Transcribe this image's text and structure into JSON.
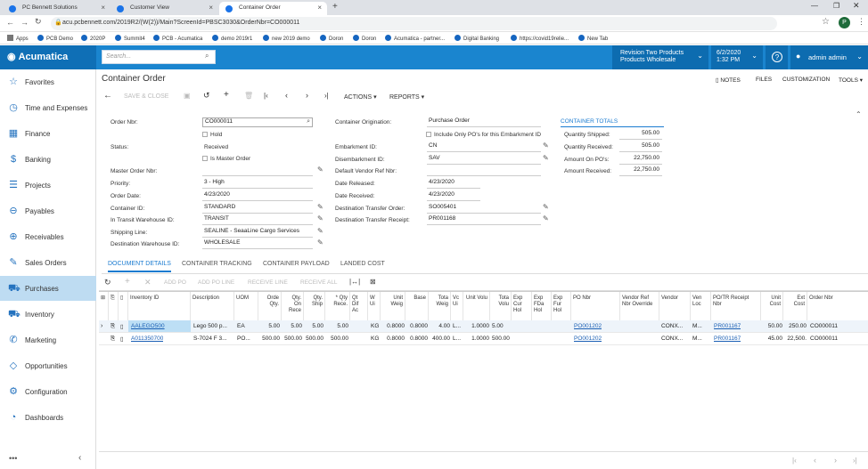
{
  "browser": {
    "tabs": [
      {
        "label": "PC Bennett Solutions"
      },
      {
        "label": "Customer View"
      },
      {
        "label": "Container Order"
      }
    ],
    "url": "acu.pcbennett.com/2019R2/(W(2))/Main?ScreenId=PBSC3030&OrderNbr=CO000011",
    "bookmarks": [
      "Apps",
      "PCB Demo",
      "2020P",
      "Summit4",
      "PCB - Acumatica",
      "demo 2019r1",
      "new 2019 demo",
      "Doron",
      "Doron",
      "Acumatica - partner...",
      "Digital Banking",
      "https://covid19relie...",
      "New Tab"
    ],
    "profile_initial": "P"
  },
  "header": {
    "logo": "Acumatica",
    "search_placeholder": "Search...",
    "company": "Revision Two Products",
    "branch": "Products Wholesale",
    "date": "6/2/2020",
    "time": "1:32 PM",
    "user": "admin admin"
  },
  "sidebar": {
    "items": [
      {
        "label": "Favorites",
        "icon": "star-icon",
        "glyph": "☆"
      },
      {
        "label": "Time and Expenses",
        "icon": "clock-icon",
        "glyph": "◷"
      },
      {
        "label": "Finance",
        "icon": "calculator-icon",
        "glyph": "▦"
      },
      {
        "label": "Banking",
        "icon": "dollar-icon",
        "glyph": "$"
      },
      {
        "label": "Projects",
        "icon": "projects-icon",
        "glyph": "☰"
      },
      {
        "label": "Payables",
        "icon": "minus-circle-icon",
        "glyph": "⊖"
      },
      {
        "label": "Receivables",
        "icon": "plus-circle-icon",
        "glyph": "⊕"
      },
      {
        "label": "Sales Orders",
        "icon": "edit-icon",
        "glyph": "✎"
      },
      {
        "label": "Purchases",
        "icon": "cart-icon",
        "glyph": "⛟"
      },
      {
        "label": "Inventory",
        "icon": "truck-icon",
        "glyph": "⛟"
      },
      {
        "label": "Marketing",
        "icon": "megaphone-icon",
        "glyph": "✆"
      },
      {
        "label": "Opportunities",
        "icon": "tag-icon",
        "glyph": "◇"
      },
      {
        "label": "Configuration",
        "icon": "gear-icon",
        "glyph": "⚙"
      },
      {
        "label": "Dashboards",
        "icon": "gauge-icon",
        "glyph": "◔"
      }
    ],
    "selected": "Purchases"
  },
  "page": {
    "title": "Container Order",
    "top_links": [
      "NOTES",
      "FILES",
      "CUSTOMIZATION",
      "TOOLS"
    ],
    "toolbar": {
      "save_close": "SAVE & CLOSE",
      "actions": "ACTIONS",
      "reports": "REPORTS"
    }
  },
  "form": {
    "col1": [
      {
        "label": "Order Nbr:",
        "value": "CO000011"
      },
      {
        "label": "",
        "value": "Hold",
        "checkbox": true
      },
      {
        "label": "Status:",
        "value": "Received"
      },
      {
        "label": "",
        "value": "Is Master Order",
        "checkbox": true
      },
      {
        "label": "Master Order Nbr:",
        "value": ""
      },
      {
        "label": "Priority:",
        "value": "3 - High"
      },
      {
        "label": "Order Date:",
        "value": "4/23/2020"
      },
      {
        "label": "Container ID:",
        "value": "STANDARD"
      },
      {
        "label": "In Transit Warehouse ID:",
        "value": "TRANSIT"
      },
      {
        "label": "Shipping Line:",
        "value": "SEALINE - SeaaLine Cargo Services"
      },
      {
        "label": "Destination Warehouse ID:",
        "value": "WHOLESALE"
      }
    ],
    "col2": [
      {
        "label": "Container Origination:",
        "value": "Purchase Order"
      },
      {
        "label": "",
        "value": "Include Only PO's for this Embarkment ID",
        "checkbox": true
      },
      {
        "label": "Embarkment ID:",
        "value": "CN"
      },
      {
        "label": "Disembarkment ID:",
        "value": "SAV"
      },
      {
        "label": "Default Vendor Ref Nbr:",
        "value": ""
      },
      {
        "label": "Date Released:",
        "value": "4/23/2020"
      },
      {
        "label": "Date Received:",
        "value": "4/23/2020"
      },
      {
        "label": "Destination Transfer Order:",
        "value": "SO005401"
      },
      {
        "label": "Destination Transfer Receipt:",
        "value": "PR001168"
      }
    ],
    "totals_title": "CONTAINER TOTALS",
    "totals": [
      {
        "label": "Quantity Shipped:",
        "value": "505.00"
      },
      {
        "label": "Quantity Received:",
        "value": "505.00"
      },
      {
        "label": "Amount On PO's:",
        "value": "22,750.00"
      },
      {
        "label": "Amount Received:",
        "value": "22,750.00"
      }
    ]
  },
  "detail_tabs": [
    "DOCUMENT DETAILS",
    "CONTAINER TRACKING",
    "CONTAINER PAYLOAD",
    "LANDED COST"
  ],
  "grid_toolbar": [
    "ADD PO",
    "ADD PO LINE",
    "RECEIVE LINE",
    "RECEIVE ALL"
  ],
  "grid": {
    "columns": [
      "Inventory ID",
      "Description",
      "UOM",
      "Orde Qty.",
      "Qty. On Rece",
      "Qty. Ship",
      "* Qty Rece.",
      "Qt Dif Ac",
      "W Ui",
      "Unit Weig",
      "Base",
      "Tota Weig",
      "Vc Ui",
      "Unit Volu",
      "Tota Volu",
      "Exp Cur Hol",
      "Exp FDa Hol",
      "Exp Fur Hol",
      "PO Nbr",
      "Vendor Ref Nbr Override",
      "Vendor",
      "Ven Loc",
      "PO/TR Receipt Nbr",
      "Unit Cost",
      "Ext Cost",
      "Order Nbr"
    ],
    "rows": [
      [
        "AALEGO500",
        "Lego 500 p...",
        "EA",
        "5.00",
        "5.00",
        "5.00",
        "5.00",
        "",
        "KG",
        "0.8000",
        "0.8000",
        "4.00",
        "L...",
        "1.0000",
        "5.00",
        "",
        "",
        "",
        "PO001202",
        "",
        "CONX...",
        "M...",
        "PR001167",
        "50.00",
        "250.00",
        "CO000011"
      ],
      [
        "A011350700",
        "S-7024 F 3...",
        "PO...",
        "500.00",
        "500.00",
        "500.00",
        "500.00",
        "",
        "KG",
        "0.8000",
        "0.8000",
        "400.00",
        "L...",
        "1.0000",
        "500.00",
        "",
        "",
        "",
        "PO001202",
        "",
        "CONX...",
        "M...",
        "PR001167",
        "45.00",
        "22,500.",
        "CO000011"
      ]
    ]
  }
}
